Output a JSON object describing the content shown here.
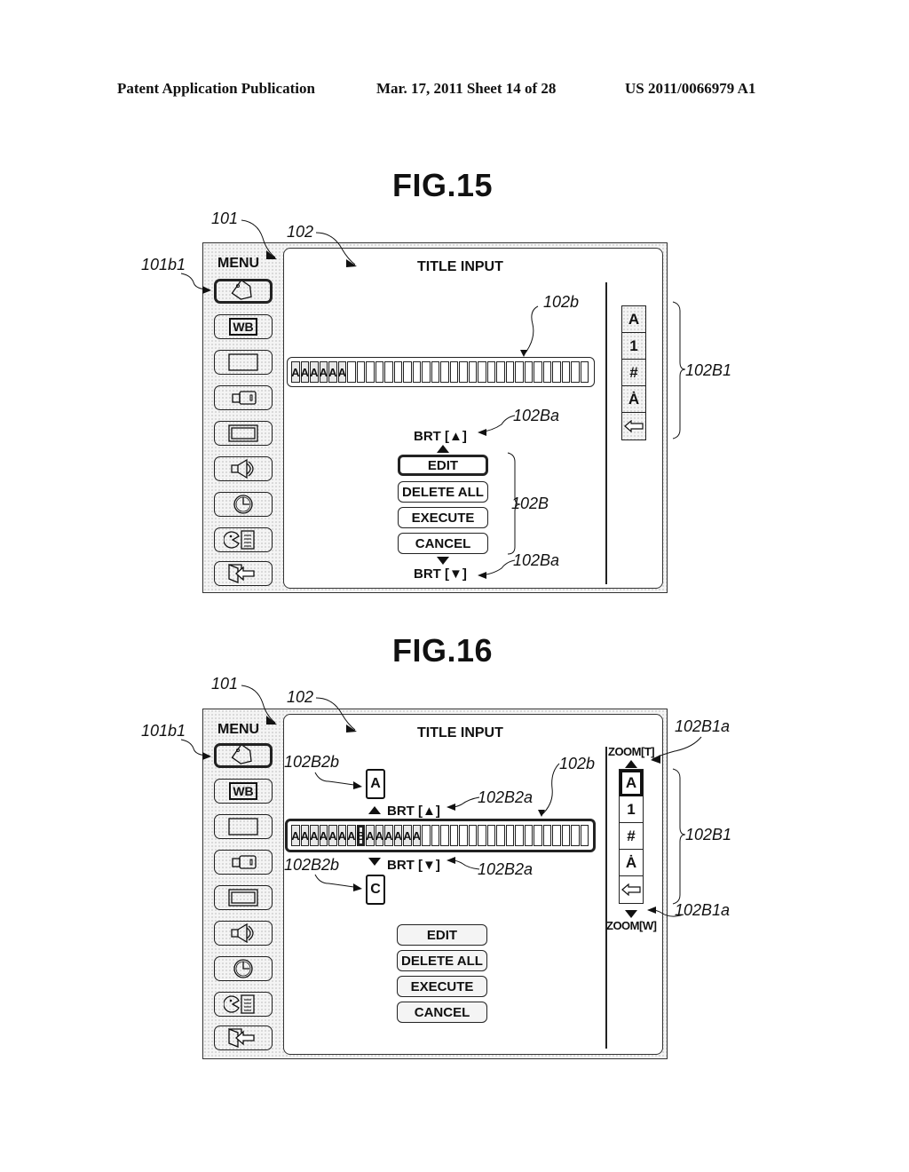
{
  "header": {
    "publication": "Patent Application Publication",
    "date_sheet": "Mar. 17, 2011  Sheet 14 of 28",
    "patent_number": "US 2011/0066979 A1"
  },
  "figures": [
    {
      "title": "FIG.15",
      "refs": {
        "screen": "101",
        "panel": "102",
        "menu_button": "101b1",
        "input_bar": "102b",
        "char_selector": "102B1",
        "buttons_group": "102B",
        "brt_up": "102Ba",
        "brt_down": "102Ba"
      },
      "menu_label": "MENU",
      "panel_title": "TITLE INPUT",
      "menu_icons": [
        "tag-icon",
        "white-balance-icon",
        "rectangle-icon",
        "usb-icon",
        "frame-icon",
        "speaker-icon",
        "clock-icon",
        "face-document-icon",
        "exit-icon"
      ],
      "menu_wb_text": "WB",
      "input_chars": [
        "A",
        "A",
        "A",
        "A",
        "A",
        "A",
        "",
        "",
        "",
        "",
        "",
        "",
        "",
        "",
        "",
        "",
        "",
        "",
        "",
        "",
        "",
        "",
        "",
        "",
        "",
        "",
        "",
        "",
        "",
        "",
        "",
        ""
      ],
      "brt_up": "BRT [▲]",
      "brt_down": "BRT [▼]",
      "buttons": [
        "EDIT",
        "DELETE ALL",
        "EXECUTE",
        "CANCEL"
      ],
      "char_types": [
        "A",
        "1",
        "#",
        "Ȧ"
      ]
    },
    {
      "title": "FIG.16",
      "refs": {
        "screen": "101",
        "panel": "102",
        "menu_button": "101b1",
        "input_bar": "102b",
        "char_selector": "102B1",
        "zoom_t": "102B1a",
        "zoom_w": "102B1a",
        "pop_up": "102B2b",
        "pop_down": "102B2b",
        "brt_up": "102B2a",
        "brt_down": "102B2a"
      },
      "menu_label": "MENU",
      "panel_title": "TITLE INPUT",
      "menu_wb_text": "WB",
      "input_chars": [
        "A",
        "A",
        "A",
        "A",
        "A",
        "A",
        "A",
        "B",
        "A",
        "A",
        "A",
        "A",
        "A",
        "A",
        "",
        "",
        "",
        "",
        "",
        "",
        "",
        "",
        "",
        "",
        "",
        "",
        "",
        "",
        "",
        "",
        "",
        ""
      ],
      "cursor_index": 7,
      "pop_prev_char": "A",
      "pop_next_char": "C",
      "brt_up": "BRT [▲]",
      "brt_down": "BRT [▼]",
      "zoom_t": "ZOOM[T]",
      "zoom_w": "ZOOM[W]",
      "buttons": [
        "EDIT",
        "DELETE ALL",
        "EXECUTE",
        "CANCEL"
      ],
      "char_types": [
        "A",
        "1",
        "#",
        "Ȧ"
      ]
    }
  ]
}
